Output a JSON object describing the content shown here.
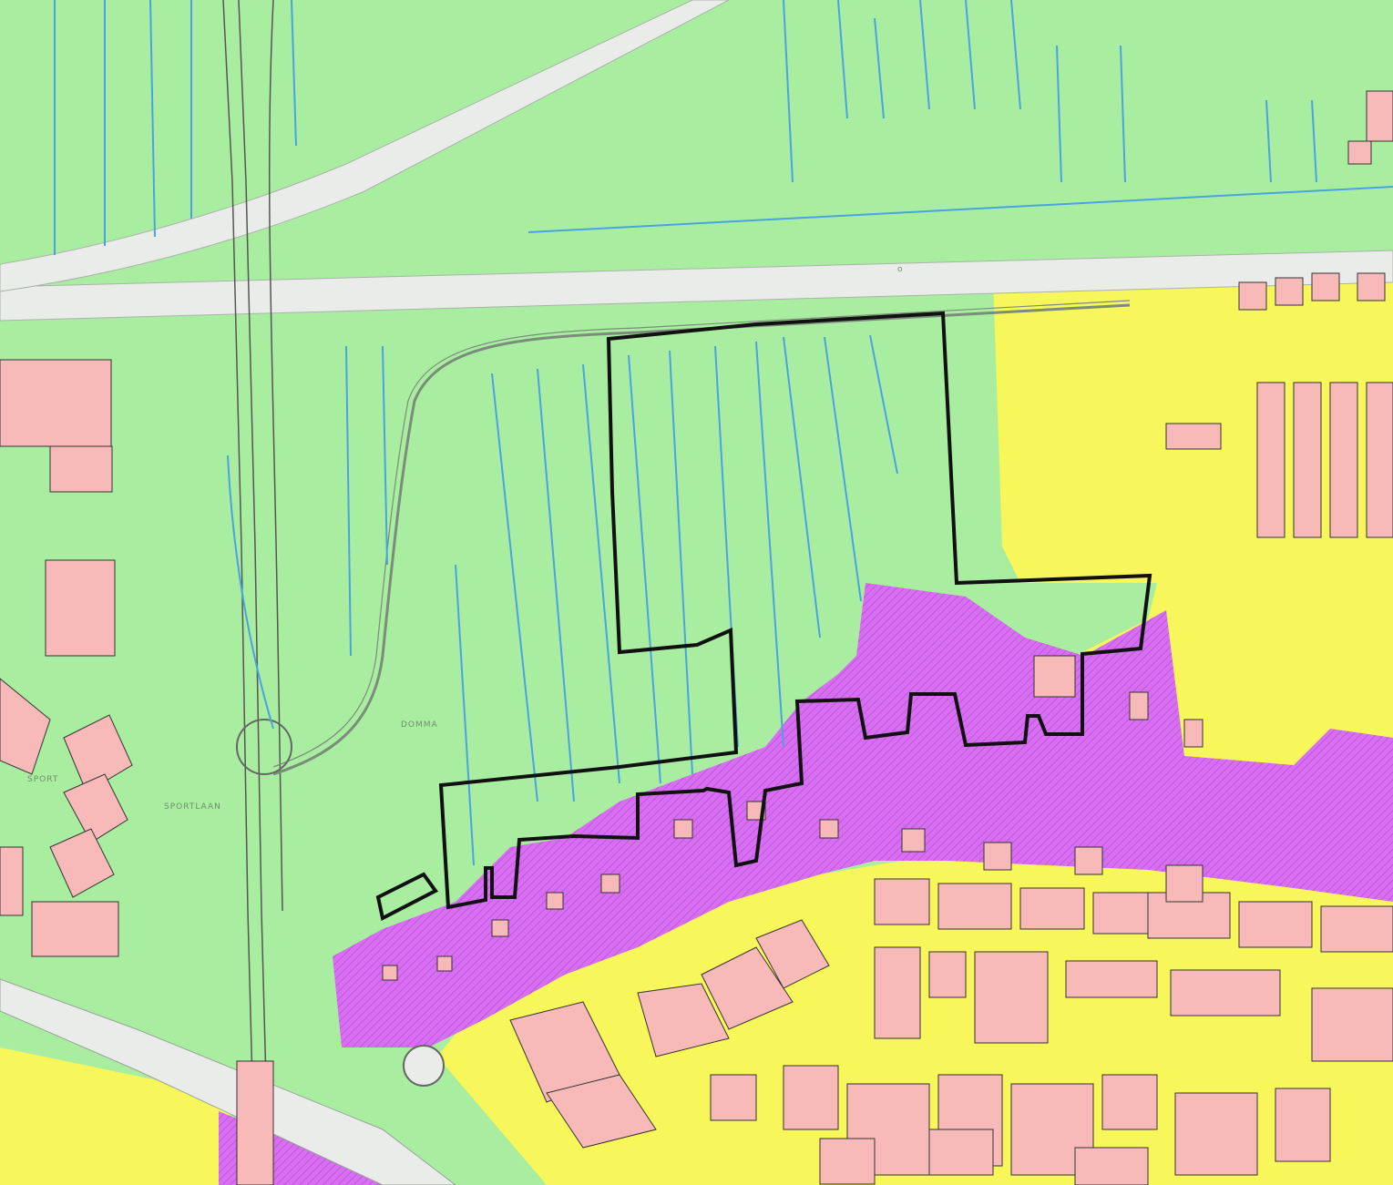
{
  "map": {
    "labels": {
      "sportlaan": "SPORTLAAN",
      "bikkelstraat": "DOMMA",
      "west_label": "SPORT",
      "road_north": "o"
    },
    "legend_colors": {
      "agrarisch": "#a9eea0",
      "bedrijf": "#f7f65a",
      "gemengd": "#d86ff2",
      "bebouwing": "#f8b9b9",
      "water": "#4aa3e0",
      "weg": "#e9ece9",
      "plangebied": "#111111"
    }
  }
}
